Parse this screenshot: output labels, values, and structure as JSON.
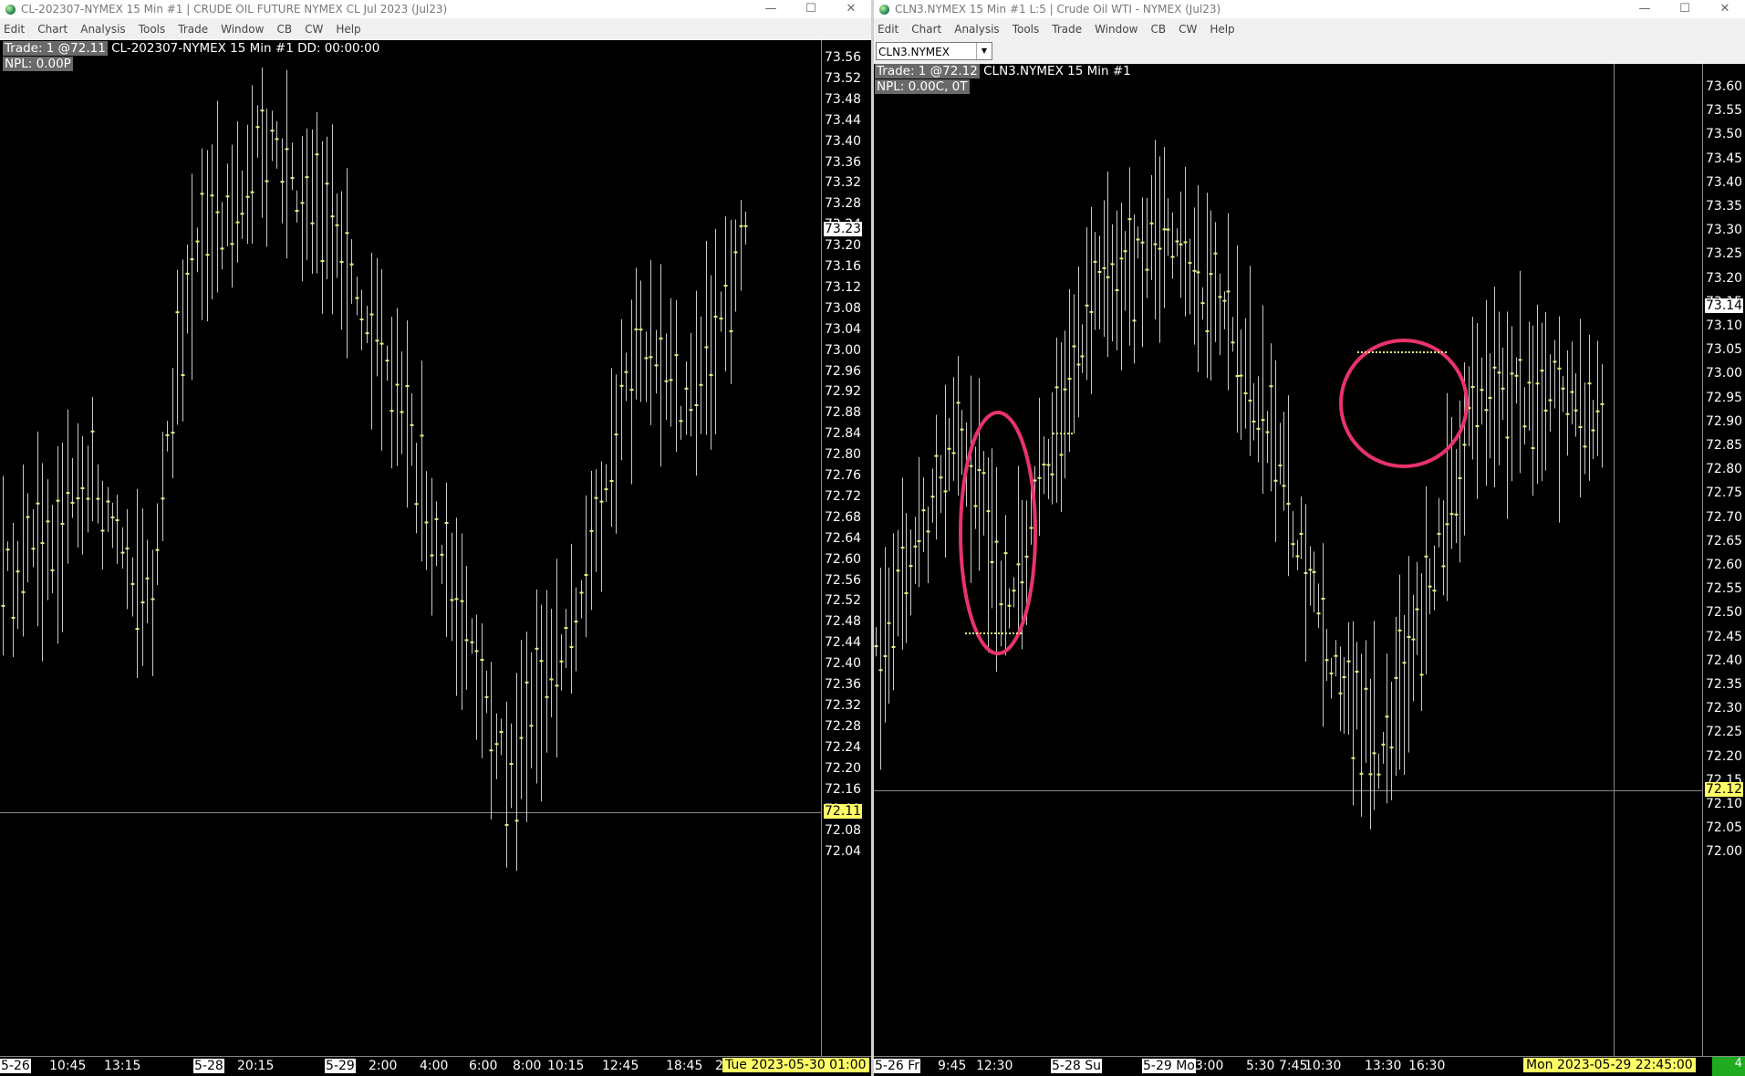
{
  "left": {
    "title": "CL-202307-NYMEX  15 Min  #1 | CRUDE OIL FUTURE NYMEX CL Jul 2023 (Jul23)",
    "menu": [
      "Edit",
      "Chart",
      "Analysis",
      "Tools",
      "Trade",
      "Window",
      "CB",
      "CW",
      "Help"
    ],
    "info_trade": "Trade: 1 @72.11",
    "info_rest": "CL-202307-NYMEX  15 Min   #1 DD: 00:00:00",
    "npl": "NPL: 0.00P",
    "price_ticks": [
      "73.56",
      "73.52",
      "73.48",
      "73.44",
      "73.40",
      "73.36",
      "73.32",
      "73.28",
      "73.24",
      "73.20",
      "73.16",
      "73.12",
      "73.08",
      "73.04",
      "73.00",
      "72.96",
      "72.92",
      "72.88",
      "72.84",
      "72.80",
      "72.76",
      "72.72",
      "72.68",
      "72.64",
      "72.60",
      "72.56",
      "72.52",
      "72.48",
      "72.44",
      "72.40",
      "72.36",
      "72.32",
      "72.28",
      "72.24",
      "72.20",
      "72.16",
      "72.12",
      "72.08",
      "72.04"
    ],
    "last_price": "73.23",
    "cursor_price": "72.11",
    "time_labels": [
      {
        "t": "5-26",
        "boxed": true
      },
      {
        "t": "10:45",
        "boxed": false
      },
      {
        "t": "13:15",
        "boxed": false
      },
      {
        "t": "5-28",
        "boxed": true
      },
      {
        "t": "20:15",
        "boxed": false
      },
      {
        "t": "5-29",
        "boxed": true
      },
      {
        "t": "2:00",
        "boxed": false
      },
      {
        "t": "4:00",
        "boxed": false
      },
      {
        "t": "6:00",
        "boxed": false
      },
      {
        "t": "8:00",
        "boxed": false
      },
      {
        "t": "10:15",
        "boxed": false
      },
      {
        "t": "12:45",
        "boxed": false
      },
      {
        "t": "18:45",
        "boxed": false
      },
      {
        "t": "2",
        "boxed": false
      }
    ],
    "timestamp": "Tue 2023-05-30  01:00"
  },
  "right": {
    "title": "CLN3.NYMEX  15 Min  #1 L:5 | Crude Oil WTI - NYMEX (Jul23)",
    "menu": [
      "Edit",
      "Chart",
      "Analysis",
      "Tools",
      "Trade",
      "Window",
      "CB",
      "CW",
      "Help"
    ],
    "symbol": "CLN3.NYMEX",
    "info_trade": "Trade: 1 @72.12",
    "info_rest": "CLN3.NYMEX  15 Min   #1",
    "npl": "NPL: 0.00C, 0T",
    "price_ticks": [
      "73.60",
      "73.55",
      "73.50",
      "73.45",
      "73.40",
      "73.35",
      "73.30",
      "73.25",
      "73.20",
      "73.15",
      "73.10",
      "73.05",
      "73.00",
      "72.95",
      "72.90",
      "72.85",
      "72.80",
      "72.75",
      "72.70",
      "72.65",
      "72.60",
      "72.55",
      "72.50",
      "72.45",
      "72.40",
      "72.35",
      "72.30",
      "72.25",
      "72.20",
      "72.15",
      "72.10",
      "72.05",
      "72.00"
    ],
    "last_price": "73.14",
    "cursor_price": "72.12",
    "time_labels": [
      {
        "t": "5-26 Fr",
        "boxed": true
      },
      {
        "t": "9:45",
        "boxed": false
      },
      {
        "t": "12:30",
        "boxed": false
      },
      {
        "t": "5-28 Su",
        "boxed": true
      },
      {
        "t": "5-29 Mo",
        "boxed": true
      },
      {
        "t": "3:00",
        "boxed": false
      },
      {
        "t": "5:30",
        "boxed": false
      },
      {
        "t": "7:45",
        "boxed": false
      },
      {
        "t": "10:30",
        "boxed": false
      },
      {
        "t": "13:30",
        "boxed": false
      },
      {
        "t": "16:30",
        "boxed": false
      }
    ],
    "timestamp": "Mon 2023-05-29  22:45:00",
    "corner": "4"
  },
  "colors": {
    "bar": "#c8c8c8",
    "tick": "#e6f07a",
    "highlight": "#e8336b",
    "cursor": "#ffff66"
  }
}
